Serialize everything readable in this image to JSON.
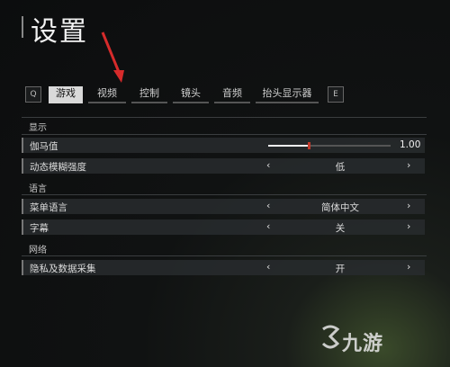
{
  "header": {
    "title": "设置"
  },
  "tabs": {
    "left_key": "Q",
    "right_key": "E",
    "items": [
      {
        "label": "游戏",
        "active": true
      },
      {
        "label": "视频"
      },
      {
        "label": "控制"
      },
      {
        "label": "镜头"
      },
      {
        "label": "音频"
      },
      {
        "label": "抬头显示器"
      }
    ]
  },
  "sections": {
    "display": {
      "label": "显示",
      "gamma": {
        "label": "伽马值",
        "value": "1.00",
        "level": 0.33
      },
      "motion_blur": {
        "label": "动态模糊强度",
        "value": "低"
      }
    },
    "language": {
      "label": "语言",
      "menu_language": {
        "label": "菜单语言",
        "value": "简体中文"
      },
      "subtitles": {
        "label": "字幕",
        "value": "关"
      }
    },
    "network": {
      "label": "网络",
      "privacy": {
        "label": "隐私及数据采集",
        "value": "开"
      }
    }
  },
  "controls": {
    "prev": "‹",
    "next": "›"
  },
  "watermark": {
    "text": "九游"
  },
  "colors": {
    "active_tab": "#d9d9d9",
    "slider_thumb": "#c0392b",
    "annotation_arrow": "#d62b2b"
  }
}
